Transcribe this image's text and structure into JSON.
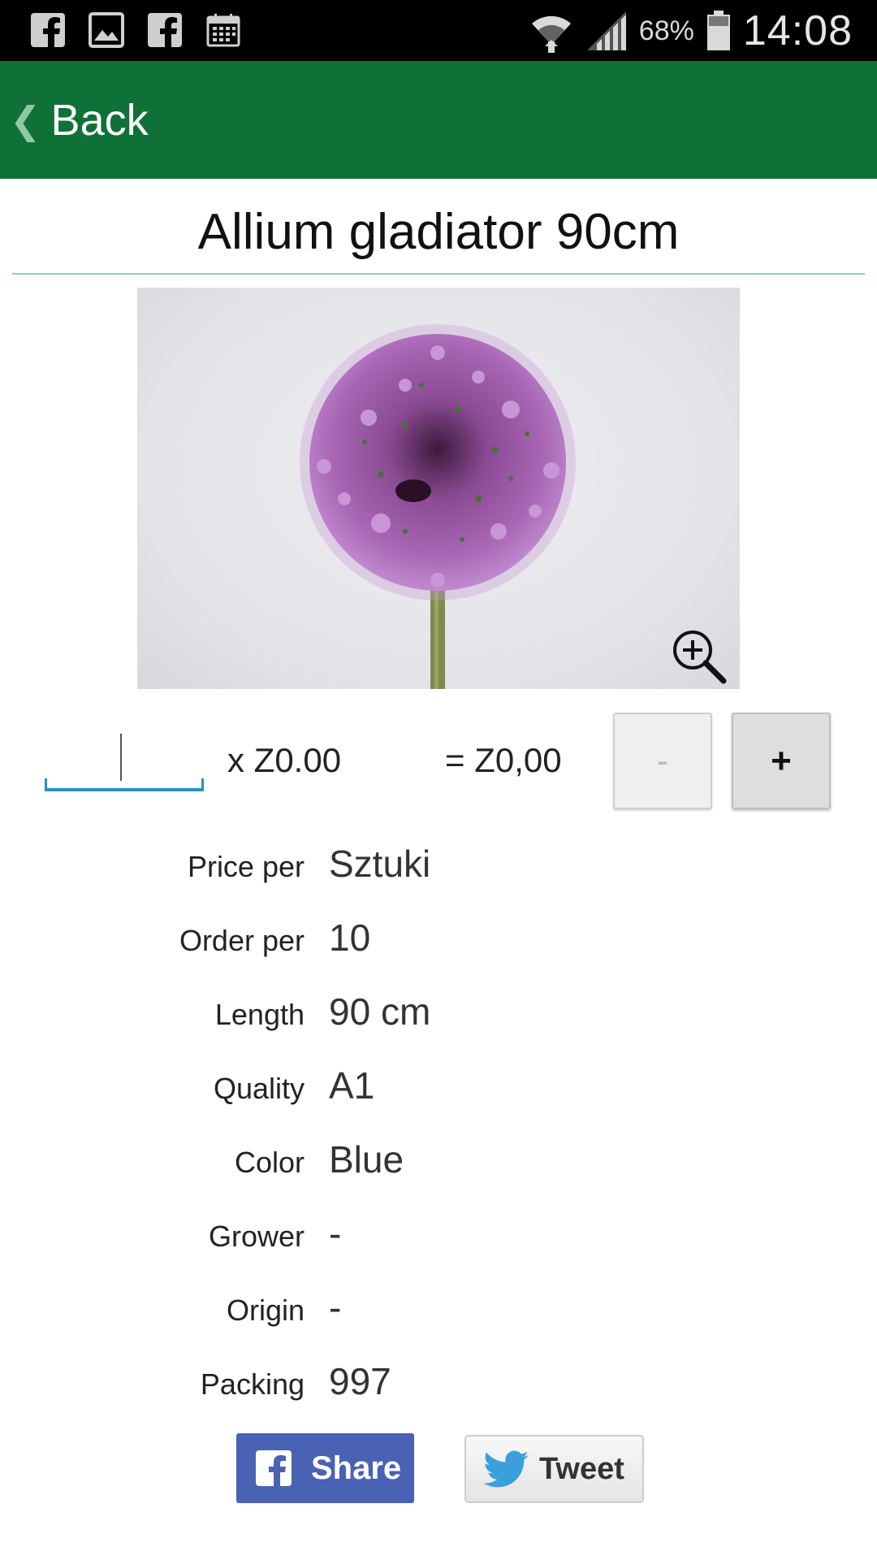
{
  "status_bar": {
    "battery_percent": "68%",
    "time": "14:08",
    "icons": [
      "facebook-icon",
      "image-icon",
      "facebook-icon",
      "calendar-icon",
      "wifi-icon",
      "signal-icon",
      "battery-icon"
    ]
  },
  "app_bar": {
    "back_chevron": "❮",
    "back_label": "Back",
    "color": "#0f7137"
  },
  "product": {
    "title": "Allium gladiator 90cm",
    "image_icon": "zoom-in-icon"
  },
  "order": {
    "quantity_value": "",
    "unit_price": "x Z0.00",
    "total_price": "= Z0,00",
    "minus_label": "-",
    "plus_label": "+"
  },
  "details": [
    {
      "label": "Price per",
      "value": "Sztuki"
    },
    {
      "label": "Order per",
      "value": "10"
    },
    {
      "label": "Length",
      "value": "90 cm"
    },
    {
      "label": "Quality",
      "value": "A1"
    },
    {
      "label": "Color",
      "value": "Blue"
    },
    {
      "label": "Grower",
      "value": "-"
    },
    {
      "label": "Origin",
      "value": "-"
    },
    {
      "label": "Packing",
      "value": "997"
    }
  ],
  "share": {
    "facebook_label": "Share",
    "twitter_label": "Tweet",
    "facebook_color": "#4a62b3"
  }
}
